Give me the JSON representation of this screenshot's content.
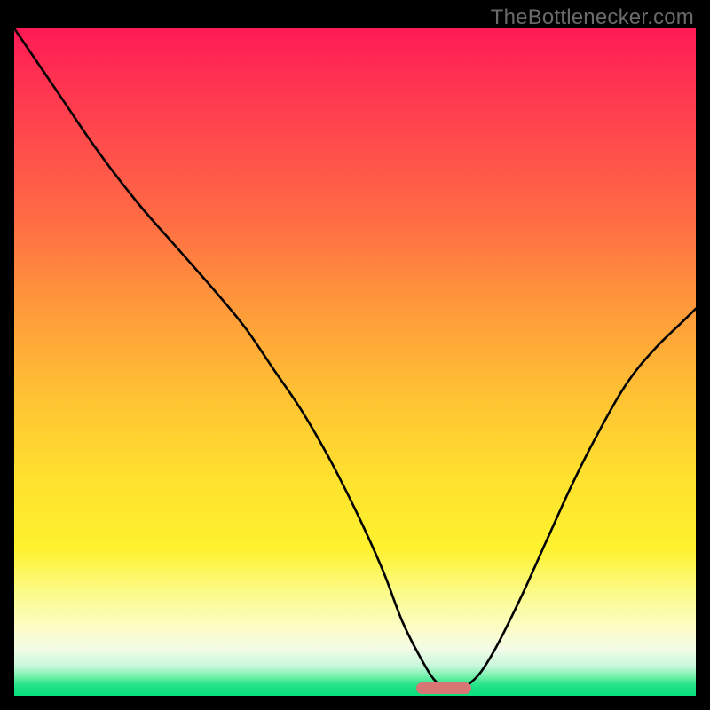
{
  "watermark": "TheBottlenecker.com",
  "chart_data": {
    "type": "line",
    "title": "",
    "xlabel": "",
    "ylabel": "",
    "xlim": [
      0,
      100
    ],
    "ylim": [
      0,
      100
    ],
    "series": [
      {
        "name": "curve",
        "x": [
          0,
          6,
          12,
          18,
          24,
          30,
          34,
          38,
          42,
          46,
          50,
          54,
          57,
          60,
          62,
          64,
          67,
          70,
          74,
          78,
          82,
          86,
          90,
          94,
          98,
          100
        ],
        "values": [
          100,
          91,
          82,
          74,
          67,
          60,
          55,
          49,
          43,
          36,
          28,
          19,
          11,
          5,
          2,
          1,
          2,
          6,
          14,
          23,
          32,
          40,
          47,
          52,
          56,
          58
        ]
      }
    ],
    "marker": {
      "x_center": 63,
      "width_pct": 8,
      "y": 0.5
    },
    "gradient_stops": [
      {
        "pct": 0,
        "color": "#ff1a55"
      },
      {
        "pct": 28,
        "color": "#ff6a45"
      },
      {
        "pct": 55,
        "color": "#ffc233"
      },
      {
        "pct": 78,
        "color": "#fef22e"
      },
      {
        "pct": 90,
        "color": "#fdfdc8"
      },
      {
        "pct": 97,
        "color": "#6ef0a8"
      },
      {
        "pct": 100,
        "color": "#07e07e"
      }
    ]
  }
}
